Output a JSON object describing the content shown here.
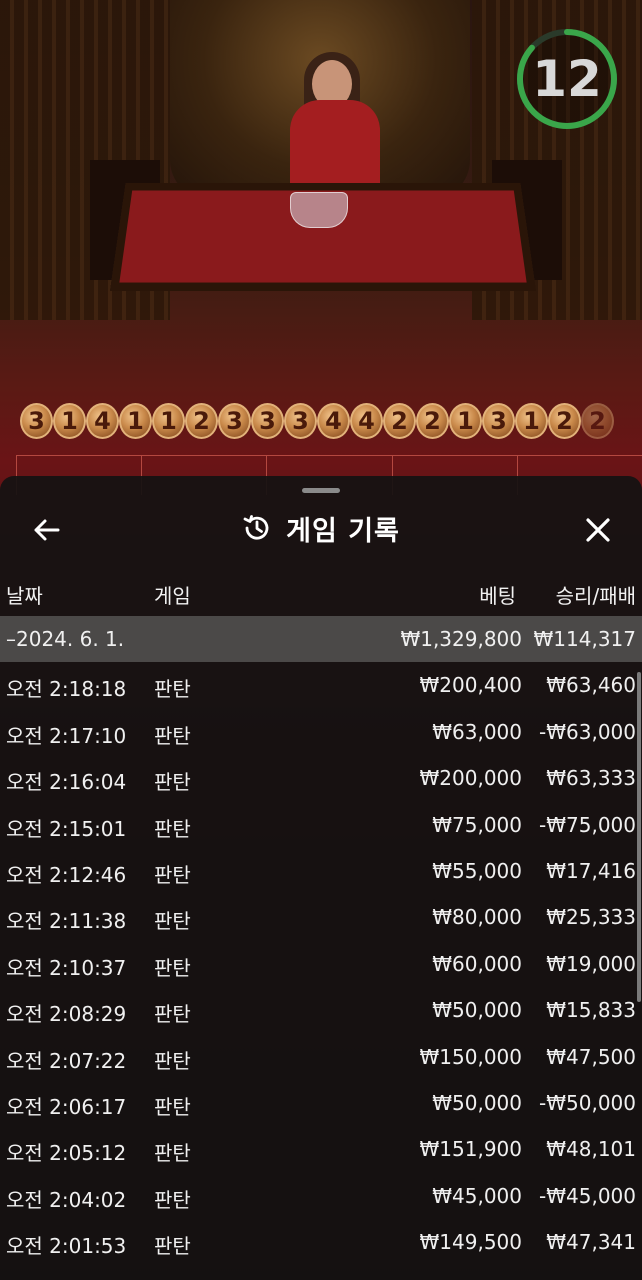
{
  "timer": {
    "value": "12"
  },
  "road": [
    "3",
    "1",
    "4",
    "1",
    "1",
    "2",
    "3",
    "3",
    "3",
    "4",
    "4",
    "2",
    "2",
    "1",
    "3",
    "1",
    "2",
    "2"
  ],
  "panel": {
    "title": "게임 기록",
    "columns": {
      "date": "날짜",
      "game": "게임",
      "bet": "베팅",
      "result": "승리/패배"
    },
    "summary": {
      "date": "–2024. 6. 1.",
      "bet": "₩1,329,800",
      "result": "₩114,317"
    },
    "rows": [
      {
        "time": "오전 2:18:18",
        "game": "판탄",
        "bet": "₩200,400",
        "result": "₩63,460"
      },
      {
        "time": "오전 2:17:10",
        "game": "판탄",
        "bet": "₩63,000",
        "result": "-₩63,000"
      },
      {
        "time": "오전 2:16:04",
        "game": "판탄",
        "bet": "₩200,000",
        "result": "₩63,333"
      },
      {
        "time": "오전 2:15:01",
        "game": "판탄",
        "bet": "₩75,000",
        "result": "-₩75,000"
      },
      {
        "time": "오전 2:12:46",
        "game": "판탄",
        "bet": "₩55,000",
        "result": "₩17,416"
      },
      {
        "time": "오전 2:11:38",
        "game": "판탄",
        "bet": "₩80,000",
        "result": "₩25,333"
      },
      {
        "time": "오전 2:10:37",
        "game": "판탄",
        "bet": "₩60,000",
        "result": "₩19,000"
      },
      {
        "time": "오전 2:08:29",
        "game": "판탄",
        "bet": "₩50,000",
        "result": "₩15,833"
      },
      {
        "time": "오전 2:07:22",
        "game": "판탄",
        "bet": "₩150,000",
        "result": "₩47,500"
      },
      {
        "time": "오전 2:06:17",
        "game": "판탄",
        "bet": "₩50,000",
        "result": "-₩50,000"
      },
      {
        "time": "오전 2:05:12",
        "game": "판탄",
        "bet": "₩151,900",
        "result": "₩48,101"
      },
      {
        "time": "오전 2:04:02",
        "game": "판탄",
        "bet": "₩45,000",
        "result": "-₩45,000"
      },
      {
        "time": "오전 2:01:53",
        "game": "판탄",
        "bet": "₩149,500",
        "result": "₩47,341"
      }
    ]
  },
  "icons": {
    "back": "arrow-left-icon",
    "history": "history-icon",
    "close": "close-icon"
  },
  "colors": {
    "timer_ring": "#3aa64a",
    "panel_bg": "#141212",
    "summary_bg": "#4b4948"
  }
}
